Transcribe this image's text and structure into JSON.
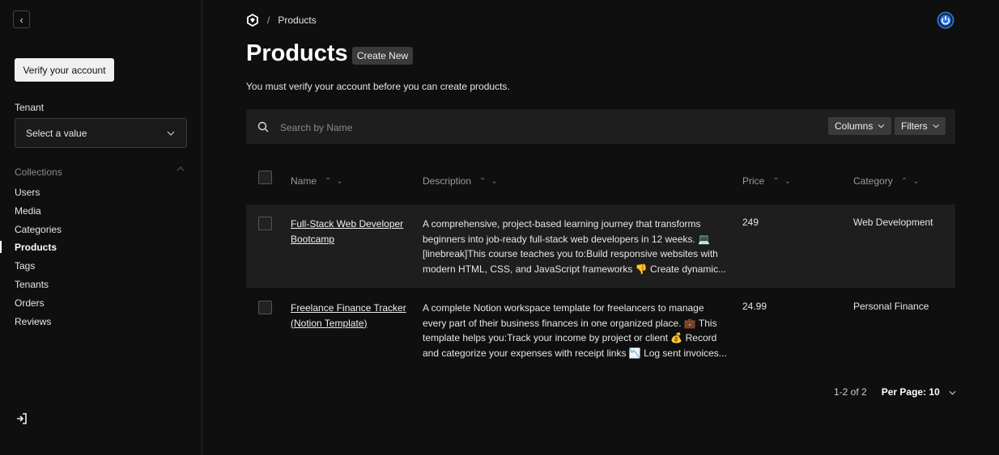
{
  "sidebar": {
    "verify_label": "Verify your account",
    "tenant_label": "Tenant",
    "tenant_placeholder": "Select a value",
    "collections_label": "Collections",
    "items": [
      "Users",
      "Media",
      "Categories",
      "Products",
      "Tags",
      "Tenants",
      "Orders",
      "Reviews"
    ],
    "active_item": "Products"
  },
  "header": {
    "breadcrumb_separator": "/",
    "breadcrumb_current": "Products"
  },
  "page": {
    "title": "Products",
    "create_label": "Create New",
    "notice": "You must verify your account before you can create products."
  },
  "search": {
    "placeholder": "Search by Name",
    "columns_label": "Columns",
    "filters_label": "Filters"
  },
  "table": {
    "columns": [
      "Name",
      "Description",
      "Price",
      "Category"
    ],
    "rows": [
      {
        "name": "Full-Stack Web Developer Bootcamp",
        "description": "A comprehensive, project-based learning journey that transforms beginners into job-ready full-stack web developers in 12 weeks. 💻 [linebreak]This course teaches you to:Build responsive websites with modern HTML, CSS, and JavaScript frameworks 👎 Create dynamic...",
        "price": "249",
        "category": "Web Development"
      },
      {
        "name": "Freelance Finance Tracker (Notion Template)",
        "description": "A complete Notion workspace template for freelancers to manage every part of their business finances in one organized place. 💼 This template helps you:Track your income by project or client 💰 Record and categorize your expenses with receipt links 📉 Log sent invoices...",
        "price": "24.99",
        "category": "Personal Finance"
      }
    ]
  },
  "pagination": {
    "range": "1-2 of 2",
    "per_page": "Per Page: 10"
  },
  "colors": {
    "background": "#0f0f0f",
    "surface": "#1e1e1e",
    "accent": "#2a6fdb"
  }
}
